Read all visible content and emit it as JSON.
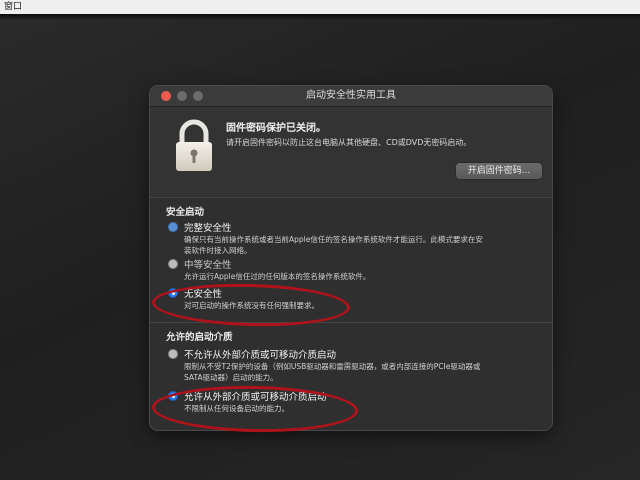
{
  "menubar": {
    "label": "窗口"
  },
  "window": {
    "title": "启动安全性实用工具",
    "firmware": {
      "title": "固件密码保护已关闭。",
      "description": "请开启固件密码以防止这台电脑从其他硬盘、CD或DVD无密码启动。",
      "button_label": "开启固件密码..."
    },
    "secure_boot": {
      "heading": "安全启动",
      "options": [
        {
          "label": "完整安全性",
          "desc_line1": "确保只有当前操作系统或者当前Apple信任的签名操作系统软件才能运行。此模式要求在安",
          "desc_line2": "装软件时接入网络。",
          "selected": false
        },
        {
          "label": "中等安全性",
          "desc_line1": "允许运行Apple信任过的任何版本的签名操作系统软件。",
          "desc_line2": "",
          "selected": false
        },
        {
          "label": "无安全性",
          "desc_line1": "对可启动的操作系统没有任何强制要求。",
          "desc_line2": "",
          "selected": true
        }
      ]
    },
    "external_boot": {
      "heading": "允许的启动介质",
      "options": [
        {
          "label": "不允许从外部介质或可移动介质启动",
          "desc_line1": "限制从不受T2保护的设备（例如USB驱动器和雷雳驱动器，或者内部连接的PCIe驱动器或",
          "desc_line2": "SATA驱动器）启动的能力。",
          "selected": false
        },
        {
          "label": "允许从外部介质或可移动介质启动",
          "desc_line1": "不限制从任何设备启动的能力。",
          "desc_line2": "",
          "selected": true
        }
      ]
    }
  },
  "colors": {
    "accent": "#2b7bf0",
    "annotation": "#b0121b",
    "close": "#ef5a50"
  },
  "icons": [
    "lock-icon",
    "radio-button"
  ]
}
